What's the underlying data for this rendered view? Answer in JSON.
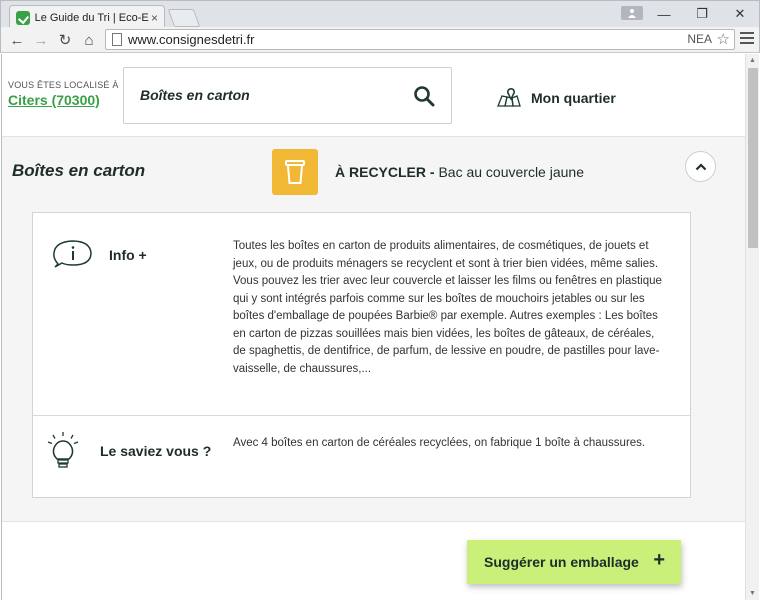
{
  "browser": {
    "tab_title": "Le Guide du Tri | Eco-Emb",
    "tab_close": "×",
    "url": "www.consignesdetri.fr",
    "omnibox_right_text": "NEA",
    "win_min": "—",
    "win_restore": "❐",
    "win_close": "✕",
    "back": "←",
    "forward": "→",
    "reload": "↻",
    "home": "⌂",
    "star": "☆"
  },
  "location": {
    "label": "VOUS ÊTES LOCALISÉ À",
    "city": "Citers (70300)"
  },
  "search": {
    "value": "Boîtes en carton",
    "icon": "search-icon"
  },
  "quartier": {
    "label": "Mon quartier",
    "icon": "map-pin-icon"
  },
  "result": {
    "title": "Boîtes en carton",
    "recycle_strong": "À RECYCLER -",
    "recycle_detail": "Bac au couvercle jaune",
    "bin_color": "#f0b834"
  },
  "info": {
    "title": "Info +",
    "text": "Toutes les boîtes en carton de produits alimentaires, de cosmétiques, de jouets et jeux, ou de produits ménagers se recyclent et sont à trier bien vidées, même salies. Vous pouvez les trier avec leur couvercle et laisser les films ou fenêtres en plastique qui y sont intégrés parfois comme sur les boîtes de mouchoirs jetables ou sur les boîtes d'emballage de poupées Barbie® par exemple. Autres exemples : Les boîtes en carton de pizzas souillées mais bien vidées, les boîtes de gâteaux, de céréales, de spaghettis, de dentifrice, de parfum, de lessive en poudre, de pastilles pour lave-vaisselle, de chaussures,..."
  },
  "saviez": {
    "title": "Le saviez vous ?",
    "text": "Avec 4 boîtes en carton de céréales recyclées, on fabrique 1 boîte à chaussures."
  },
  "suggest": {
    "label": "Suggérer un emballage",
    "plus": "+",
    "color": "#cbf07a"
  },
  "colors": {
    "brand_green": "#3aa046",
    "text_dark": "#1f2d2a"
  }
}
